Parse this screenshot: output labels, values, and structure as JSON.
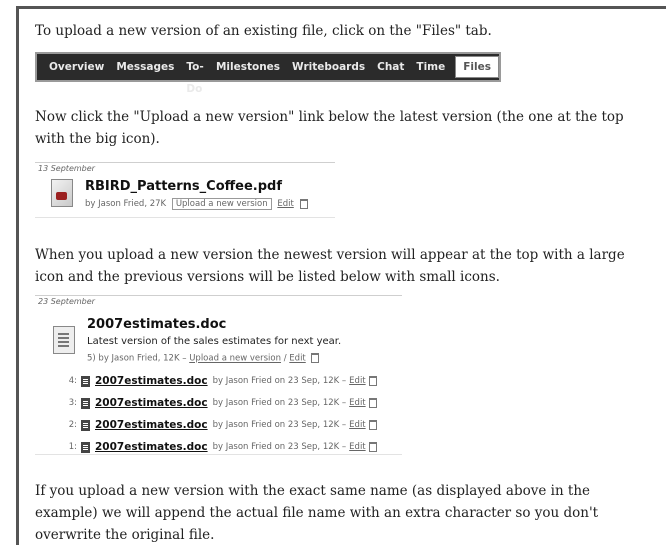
{
  "para1": "To upload a new version of an existing file, click on the \"Files\" tab.",
  "tabs": [
    "Overview",
    "Messages",
    "To-Do",
    "Milestones",
    "Writeboards",
    "Chat",
    "Time",
    "Files"
  ],
  "para2": "Now click the \"Upload a new version\" link below the latest version (the one at the top with the big icon).",
  "box1": {
    "date": "13 September",
    "filename": "RBIRD_Patterns_Coffee.pdf",
    "meta": "by Jason Fried, 27K",
    "upload": "Upload a new version",
    "edit": "Edit"
  },
  "para3": "When you upload a new version the newest version will appear at the top with a large icon and the previous versions will be listed below with small icons.",
  "box2": {
    "date": "23 September",
    "filename": "2007estimates.doc",
    "description": "Latest version of the sales estimates for next year.",
    "meta_prefix": "5) by Jason Fried, 12K –",
    "upload": "Upload a new version",
    "sep": "/",
    "edit": "Edit",
    "rows": [
      {
        "num": "4:",
        "name": "2007estimates.doc",
        "meta": "by Jason Fried on 23 Sep, 12K –",
        "edit": "Edit"
      },
      {
        "num": "3:",
        "name": "2007estimates.doc",
        "meta": "by Jason Fried on 23 Sep, 12K –",
        "edit": "Edit"
      },
      {
        "num": "2:",
        "name": "2007estimates.doc",
        "meta": "by Jason Fried on 23 Sep, 12K –",
        "edit": "Edit"
      },
      {
        "num": "1:",
        "name": "2007estimates.doc",
        "meta": "by Jason Fried on 23 Sep, 12K –",
        "edit": "Edit"
      }
    ]
  },
  "para4": "If you upload a new version with the exact same name (as displayed above in the example) we will append the actual file name with an extra character so you don't overwrite the original file."
}
